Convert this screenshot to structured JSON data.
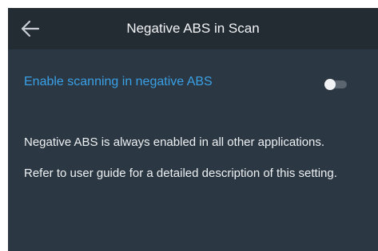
{
  "header": {
    "title": "Negative ABS in Scan",
    "back_icon": "arrow-left-icon"
  },
  "setting": {
    "label": "Enable scanning in negative ABS",
    "toggle_state": "off"
  },
  "info": {
    "line1": "Negative ABS is always enabled in all other applications.",
    "line2": "Refer to user guide for a detailed description of this setting."
  },
  "colors": {
    "background": "#2b3742",
    "header_background": "#232b33",
    "accent": "#3aa0e6",
    "text": "#eef1f3"
  }
}
